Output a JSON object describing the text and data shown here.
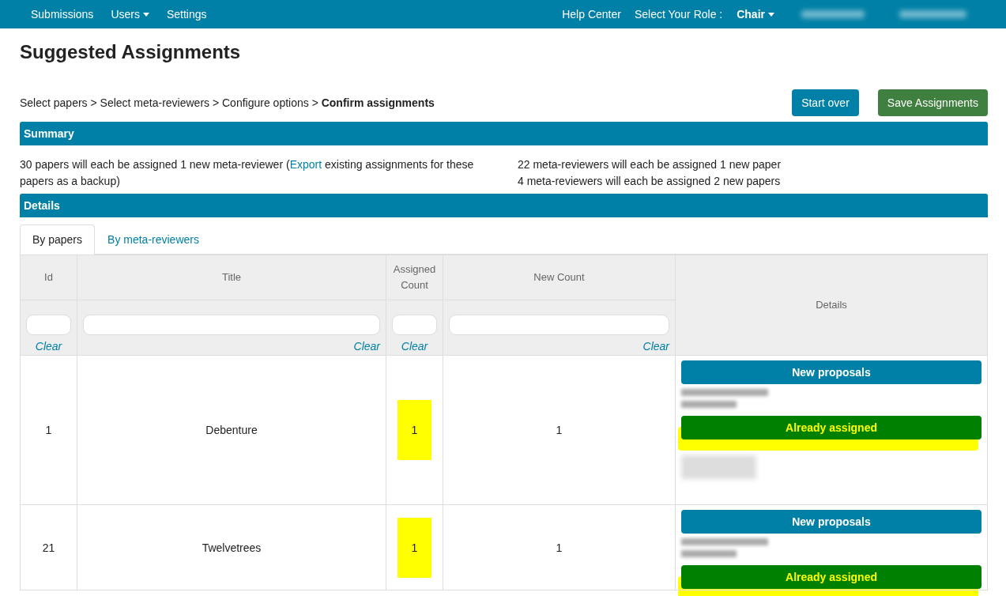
{
  "nav": {
    "left": [
      {
        "label": "Submissions",
        "dropdown": false
      },
      {
        "label": "Users",
        "dropdown": true
      },
      {
        "label": "Settings",
        "dropdown": false
      }
    ],
    "help": "Help Center",
    "role_label": "Select Your Role :",
    "role": "Chair"
  },
  "title": "Suggested Assignments",
  "breadcrumb": {
    "steps": [
      "Select papers",
      "Select meta-reviewers",
      "Configure options"
    ],
    "current": "Confirm assignments",
    "separator": ">"
  },
  "buttons": [
    {
      "label": "Start over",
      "kind": "primary"
    },
    {
      "label": "Save Assignments",
      "kind": "success"
    }
  ],
  "summary": {
    "heading": "Summary",
    "left": {
      "before": "30 papers will each be assigned 1 new meta-reviewer (",
      "link": "Export",
      "after": " existing assignments for these papers as a backup)"
    },
    "right": [
      "22 meta-reviewers will each be assigned 1 new paper",
      "4 meta-reviewers will each be assigned 2 new papers"
    ]
  },
  "details_heading": "Details",
  "tabs": [
    {
      "label": "By papers",
      "selected": true
    },
    {
      "label": "By meta-reviewers",
      "selected": false
    }
  ],
  "table": {
    "columns": [
      {
        "label": "Id",
        "clear": "Clear"
      },
      {
        "label": "Title",
        "clear": "Clear"
      },
      {
        "label": "Assigned Count",
        "clear": "Clear"
      },
      {
        "label": "New Count",
        "clear": "Clear"
      },
      {
        "label": "Details"
      }
    ],
    "rows": [
      {
        "id": "1",
        "title": "Debenture",
        "assigned": "1",
        "assigned_highlight": true,
        "new": "1",
        "proposals": "New proposals",
        "assigned_label": "Already assigned",
        "assigned_flag": true
      },
      {
        "id": "21",
        "title": "Twelvetrees",
        "assigned": "1",
        "assigned_highlight": true,
        "new": "1",
        "proposals": "New proposals",
        "assigned_label": "Already assigned",
        "assigned_flag": true
      }
    ]
  }
}
